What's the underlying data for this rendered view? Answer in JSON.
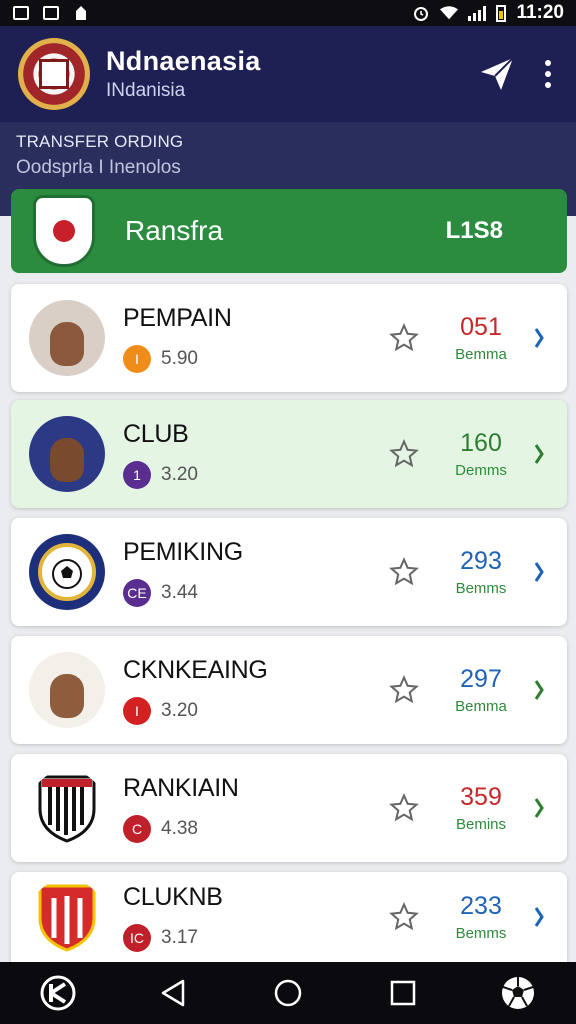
{
  "status_bar": {
    "time": "11:20"
  },
  "app_bar": {
    "title": "Ndnaenasia",
    "subtitle": "INdanisia"
  },
  "subheader": {
    "line1": "TRANSFER ORDING",
    "line2": "Oodsprla I Inenolos"
  },
  "banner": {
    "title": "Ransfra",
    "value": "L1S8"
  },
  "colors": {
    "appbar": "#1e2054",
    "banner_green": "#2b8c3f",
    "highlight_row": "#e4f5e4",
    "score_red": "#c62828",
    "score_green": "#2e7d32",
    "score_blue": "#1e63b4"
  },
  "rows": [
    {
      "name": "PEMPAIN",
      "badge": "I",
      "badge_color": "#f08c1a",
      "meta": "5.90",
      "score": "051",
      "score_color": "#c62828",
      "score_label": "Bemma",
      "chev_color": "#1e63b4",
      "avatar": "player-photo",
      "highlighted": false
    },
    {
      "name": "CLUB",
      "badge": "1",
      "badge_color": "#5a2d91",
      "meta": "3.20",
      "score": "160",
      "score_color": "#2e7d32",
      "score_label": "Demms",
      "chev_color": "#2e7d32",
      "avatar": "player-photo",
      "highlighted": true
    },
    {
      "name": "PEMIKING",
      "badge": "CE",
      "badge_color": "#5a2d91",
      "meta": "3.44",
      "score": "293",
      "score_color": "#1e63b4",
      "score_label": "Bemms",
      "chev_color": "#1e63b4",
      "avatar": "club-crest",
      "highlighted": false
    },
    {
      "name": "CKNKEAING",
      "badge": "I",
      "badge_color": "#d32020",
      "meta": "3.20",
      "score": "297",
      "score_color": "#1e63b4",
      "score_label": "Bemma",
      "chev_color": "#2e7d32",
      "avatar": "player-photo",
      "highlighted": false
    },
    {
      "name": "RANKIAIN",
      "badge": "C",
      "badge_color": "#c0202a",
      "meta": "4.38",
      "score": "359",
      "score_color": "#c62828",
      "score_label": "Bemins",
      "chev_color": "#2e7d32",
      "avatar": "club-crest",
      "highlighted": false
    },
    {
      "name": "CLUKNB",
      "badge": "IC",
      "badge_color": "#c0202a",
      "meta": "3.17",
      "score": "233",
      "score_color": "#1e63b4",
      "score_label": "Bemms",
      "chev_color": "#1e63b4",
      "avatar": "club-crest",
      "highlighted": false
    }
  ]
}
